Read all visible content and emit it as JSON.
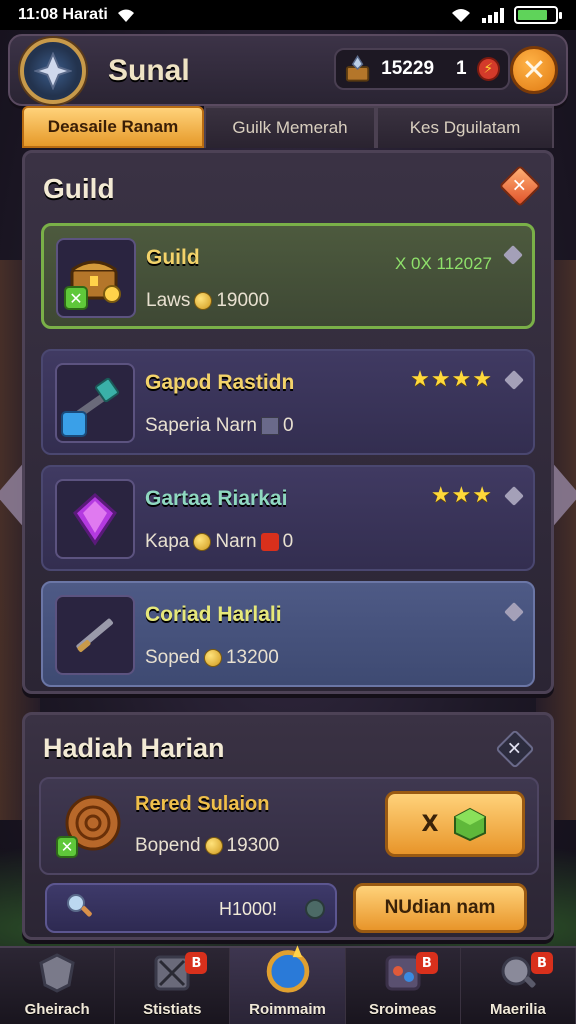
{
  "status_bar": {
    "time": "11:08 Harati"
  },
  "header": {
    "title": "Sunal",
    "currency_amount": "15229",
    "currency_count": "1"
  },
  "tabs": [
    {
      "label": "Deasaile Ranam",
      "active": true
    },
    {
      "label": "Guilk Memerah",
      "active": false
    },
    {
      "label": "Kes Dguilatam",
      "active": false
    }
  ],
  "guild_panel": {
    "title": "Guild",
    "items": [
      {
        "name": "Guild",
        "sub_prefix": "Laws",
        "sub_value": "19000",
        "reward": "X 0X 112027",
        "stars": ""
      },
      {
        "name": "Gapod Rastidn",
        "sub_prefix": "Saperia Narn",
        "sub_value": "0",
        "reward": "",
        "stars": "★★★★"
      },
      {
        "name": "Gartaa Riarkai",
        "sub_prefix": "Kapa",
        "sub_value": "Narn",
        "sub_value2": "0",
        "reward": "",
        "stars": "★★★"
      },
      {
        "name": "Coriad Harlali",
        "sub_prefix": "Soped",
        "sub_value": "13200",
        "reward": "",
        "stars": ""
      }
    ]
  },
  "daily_panel": {
    "title": "Hadiah Harian",
    "reward_name": "Rered Sulaion",
    "reward_sub_prefix": "Bopend",
    "reward_sub_value": "19300",
    "claim_label": "X",
    "search_value": "H1000!",
    "action_label": "NUdian nam"
  },
  "bottom_nav": [
    {
      "label": "Gheirach",
      "badge": "",
      "active": false
    },
    {
      "label": "Stistiats",
      "badge": "B",
      "active": false
    },
    {
      "label": "Roimmaim",
      "badge": "",
      "active": true
    },
    {
      "label": "Sroimeas",
      "badge": "B",
      "active": false
    },
    {
      "label": "Maerilia",
      "badge": "B",
      "active": false
    }
  ],
  "colors": {
    "accent": "#e8952a",
    "panel": "#2b2534",
    "star": "#ffd93a"
  }
}
